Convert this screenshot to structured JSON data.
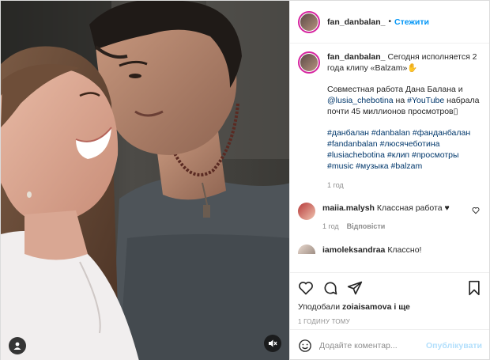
{
  "header": {
    "username": "fan_danbalan_",
    "separator": "•",
    "follow_label": "Стежити"
  },
  "caption": {
    "username": "fan_danbalan_",
    "line1": "Сегодня исполняется 2 года клипу «Balzam»✋",
    "p2_a": "Совместная работа Дана Балана и ",
    "p2_mention": "@lusia_chebotina",
    "p2_b": " на ",
    "p2_tag": "#YouTube",
    "p2_c": " набрала почти 45 миллионов просмотров▯",
    "hashtags": "#данбалан #danbalan #фанданбалан #fandanbalan #люсячеботина #lusiachebotina #клип #просмотры #music #музыка #balzam",
    "time": "1 год"
  },
  "comments": [
    {
      "username": "maiia.malysh",
      "text": "Классная работа ♥",
      "time": "1 год",
      "reply": "Відповісти"
    },
    {
      "username": "iamoleksandraa",
      "text": "Классно!"
    }
  ],
  "likes": {
    "prefix": "Уподобали ",
    "user": "zoiaisamova",
    "suffix": " і ще"
  },
  "posted_time": "1 годину тому",
  "add_comment": {
    "placeholder": "Додайте коментар...",
    "publish_label": "Опублікувати"
  },
  "icons": {
    "heart": "heart-icon",
    "comment": "comment-icon",
    "share": "share-icon",
    "save": "bookmark-icon",
    "emoji": "emoji-icon",
    "user": "user-tag-icon",
    "mute": "mute-icon"
  },
  "colors": {
    "accent": "#0095f6",
    "heart_red": "#ed4956",
    "muted": "#8e8e8e"
  }
}
